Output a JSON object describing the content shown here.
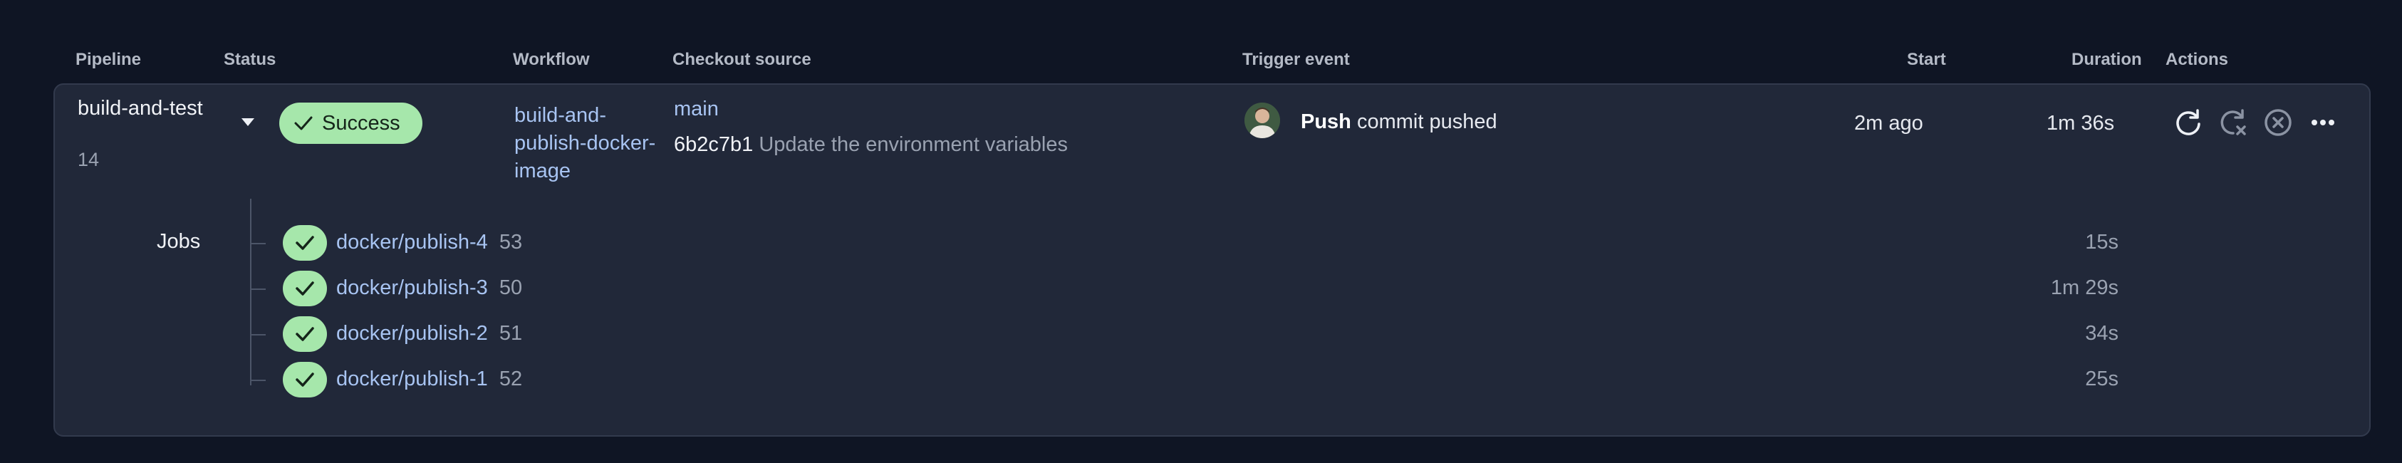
{
  "headers": {
    "pipeline": "Pipeline",
    "status": "Status",
    "workflow": "Workflow",
    "checkout": "Checkout source",
    "trigger": "Trigger event",
    "start": "Start",
    "duration": "Duration",
    "actions": "Actions"
  },
  "pipeline": {
    "name": "build-and-test",
    "number": "14",
    "status": "Success",
    "workflow": "build-and-publish-docker-image",
    "branch": "main",
    "commit_sha": "6b2c7b1",
    "commit_message": "Update the environment variables",
    "trigger_bold": "Push",
    "trigger_rest": "commit pushed",
    "start": "2m ago",
    "duration": "1m 36s"
  },
  "actions": [
    "rerun-icon",
    "rerun-failed-icon",
    "cancel-icon",
    "more-icon"
  ],
  "jobs_label": "Jobs",
  "jobs": [
    {
      "name": "docker/publish-4",
      "number": "53",
      "duration": "15s"
    },
    {
      "name": "docker/publish-3",
      "number": "50",
      "duration": "1m 29s"
    },
    {
      "name": "docker/publish-2",
      "number": "51",
      "duration": "34s"
    },
    {
      "name": "docker/publish-1",
      "number": "52",
      "duration": "25s"
    }
  ],
  "colors": {
    "background": "#0f1524",
    "card": "#212839",
    "success": "#a6e7ab",
    "link": "#a8c4f2",
    "muted": "#9aa2b1"
  }
}
